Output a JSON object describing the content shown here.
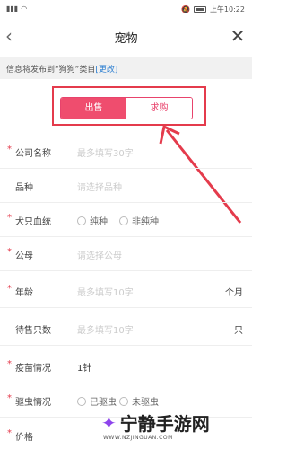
{
  "status_bar": {
    "time": "上午10:22"
  },
  "nav": {
    "title": "宠物"
  },
  "notice": {
    "text": "信息将发布到“狗狗”类目",
    "link": "[更改]"
  },
  "segmented": {
    "sell": "出售",
    "buy": "求购",
    "active": "出售"
  },
  "form": {
    "company": {
      "label": "公司名称",
      "placeholder": "最多填写30字"
    },
    "breed": {
      "label": "品种",
      "placeholder": "请选择品种"
    },
    "bloodline": {
      "label": "犬只血统",
      "option1": "纯种",
      "option2": "非纯种"
    },
    "sire": {
      "label": "公母",
      "placeholder": "请选择公母"
    },
    "age": {
      "label": "年龄",
      "placeholder": "最多填写10字",
      "unit": "个月"
    },
    "quantity": {
      "label": "待售只数",
      "placeholder": "最多填写10字",
      "unit": "只"
    },
    "vaccine": {
      "label": "疫苗情况",
      "value": "1针"
    },
    "deworm": {
      "label": "驱虫情况",
      "option1": "已驱虫",
      "option2": "未驱虫"
    },
    "price": {
      "label": "价格"
    }
  },
  "watermark": {
    "title": "宁静手游网",
    "url": "WWW.NZJINGUAN.COM"
  },
  "colors": {
    "accent": "#ef4d6e",
    "highlight": "#e43b4c",
    "link": "#2d7fd1"
  }
}
